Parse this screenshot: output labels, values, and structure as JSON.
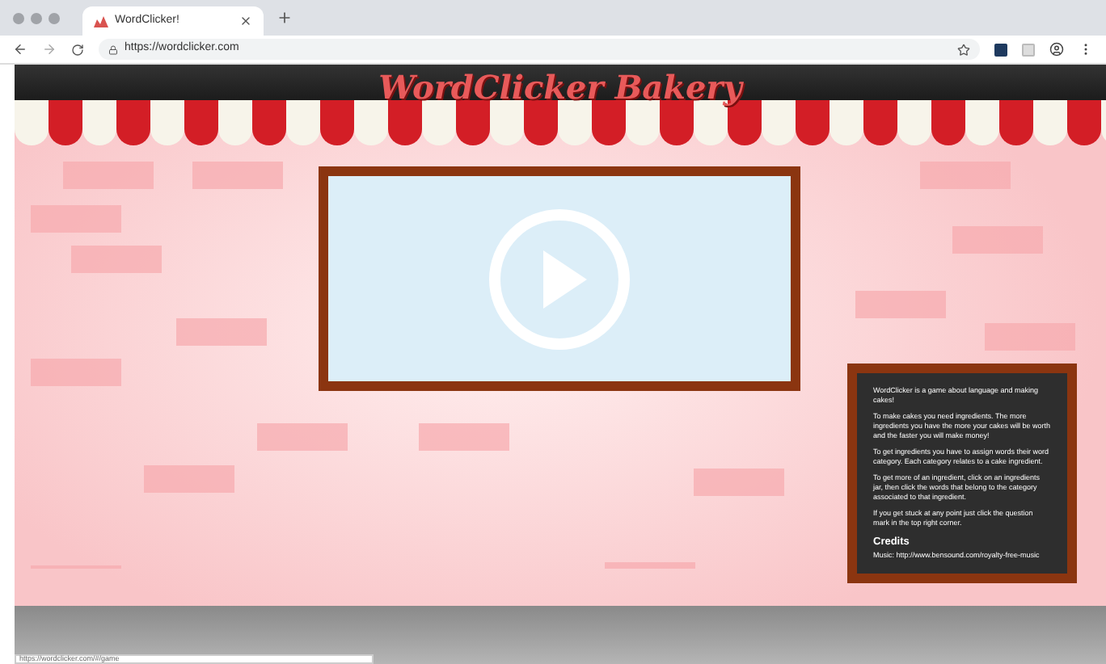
{
  "browser": {
    "tabs": [
      {
        "title": "WordClicker!",
        "selected": true
      }
    ],
    "url": "https://wordclicker.com",
    "status_url": "https://wordclicker.com/#/game"
  },
  "page": {
    "title": "WordClicker Bakery",
    "chalkboard": {
      "paragraphs": [
        "WordClicker is a game about language and making cakes!",
        "To make cakes you need ingredients. The more ingredients you have the more your cakes will be worth and the faster you will make money!",
        "To get ingredients you have to assign words their word category. Each category relates to a cake ingredient.",
        "To get more of an ingredient, click on an ingredients jar, then click the words that belong to the category associated to that ingredient.",
        "If you get stuck at any point just click the question mark in the top right corner."
      ],
      "credits_heading": "Credits",
      "credits_text": "Music: http://www.bensound.com/royalty-free-music"
    }
  }
}
